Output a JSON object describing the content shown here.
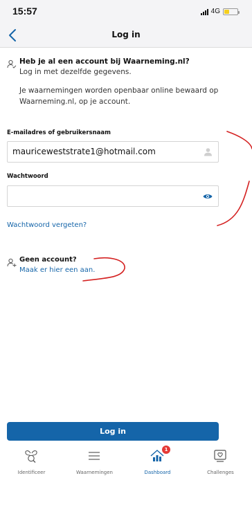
{
  "status_bar": {
    "time": "15:57",
    "network": "4G",
    "battery_level": 0.4,
    "battery_color": "#f5cf1e"
  },
  "nav": {
    "title": "Log in"
  },
  "intro": {
    "heading": "Heb je al een account bij Waarneming.nl?",
    "subheading": "Log in met dezelfde gegevens.",
    "body": "Je waarnemingen worden openbaar online bewaard op Waarneming.nl, op je account."
  },
  "form": {
    "email_label": "E-mailadres of gebruikersnaam",
    "email_value": "mauriceweststrate1@hotmail.com",
    "password_label": "Wachtwoord",
    "password_value": "",
    "forgot_link": "Wachtwoord vergeten?"
  },
  "no_account": {
    "title": "Geen account?",
    "link": "Maak er hier een aan."
  },
  "login_button": "Log in",
  "tabs": [
    {
      "label": "Identificeer",
      "icon": "butterfly-search-icon",
      "active": false
    },
    {
      "label": "Waarnemingen",
      "icon": "list-icon",
      "active": false
    },
    {
      "label": "Dashboard",
      "icon": "bar-chart-icon",
      "active": true,
      "badge": "1"
    },
    {
      "label": "Challenges",
      "icon": "challenge-icon",
      "active": false
    }
  ],
  "colors": {
    "accent": "#1565a9",
    "badge": "#e53935",
    "annotation": "#d42020"
  }
}
